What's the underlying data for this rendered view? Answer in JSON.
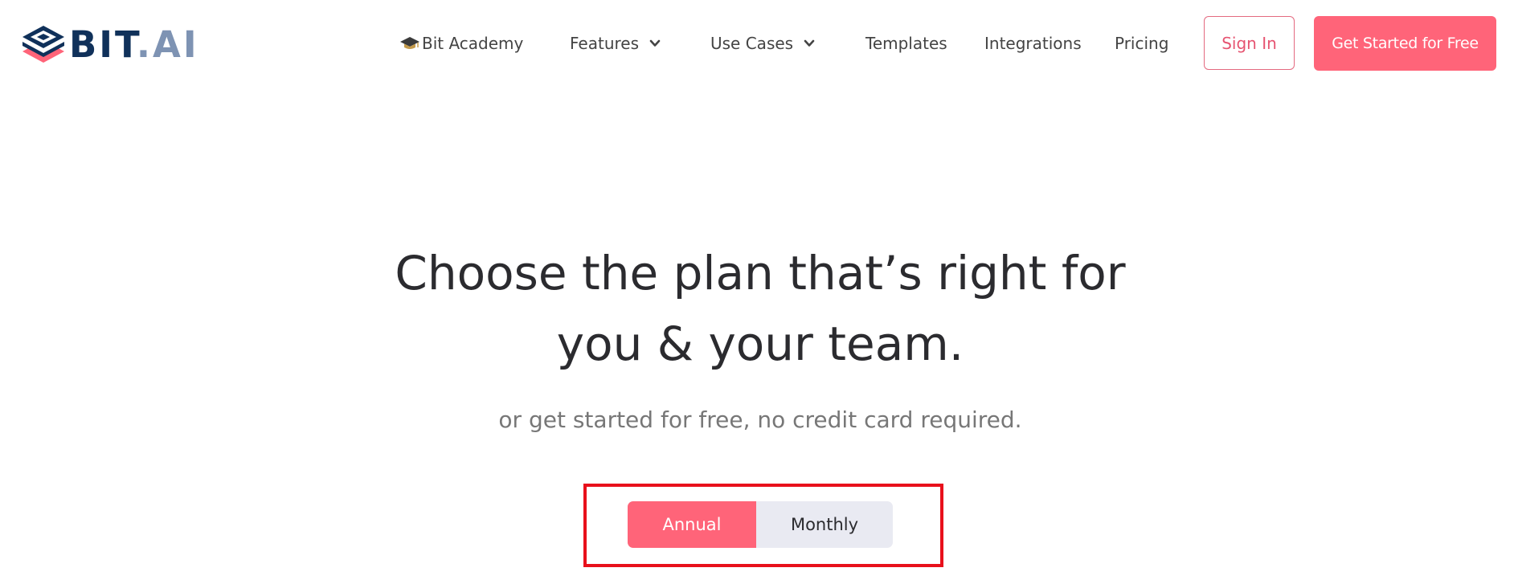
{
  "brand": {
    "logo_bit": "BIT",
    "logo_ai": ".AI",
    "colors": {
      "brand_navy": "#10315a",
      "brand_slate": "#7e93b3",
      "accent_pink": "#ff6479",
      "highlight_red": "#e8101b"
    }
  },
  "nav": {
    "academy": {
      "label": "Bit Academy",
      "icon": "graduation-cap-icon"
    },
    "features": {
      "label": "Features",
      "icon": "chevron-down-icon"
    },
    "use_cases": {
      "label": "Use Cases",
      "icon": "chevron-down-icon"
    },
    "templates": {
      "label": "Templates"
    },
    "integrations": {
      "label": "Integrations"
    },
    "pricing": {
      "label": "Pricing"
    },
    "sign_in": "Sign In",
    "get_started": "Get Started for Free"
  },
  "hero": {
    "title_line1": "Choose the plan that’s right for",
    "title_line2": "you & your team.",
    "subtitle": "or get started for free, no credit card required."
  },
  "billing_toggle": {
    "options": [
      "Annual",
      "Monthly"
    ],
    "selected": "Annual"
  }
}
